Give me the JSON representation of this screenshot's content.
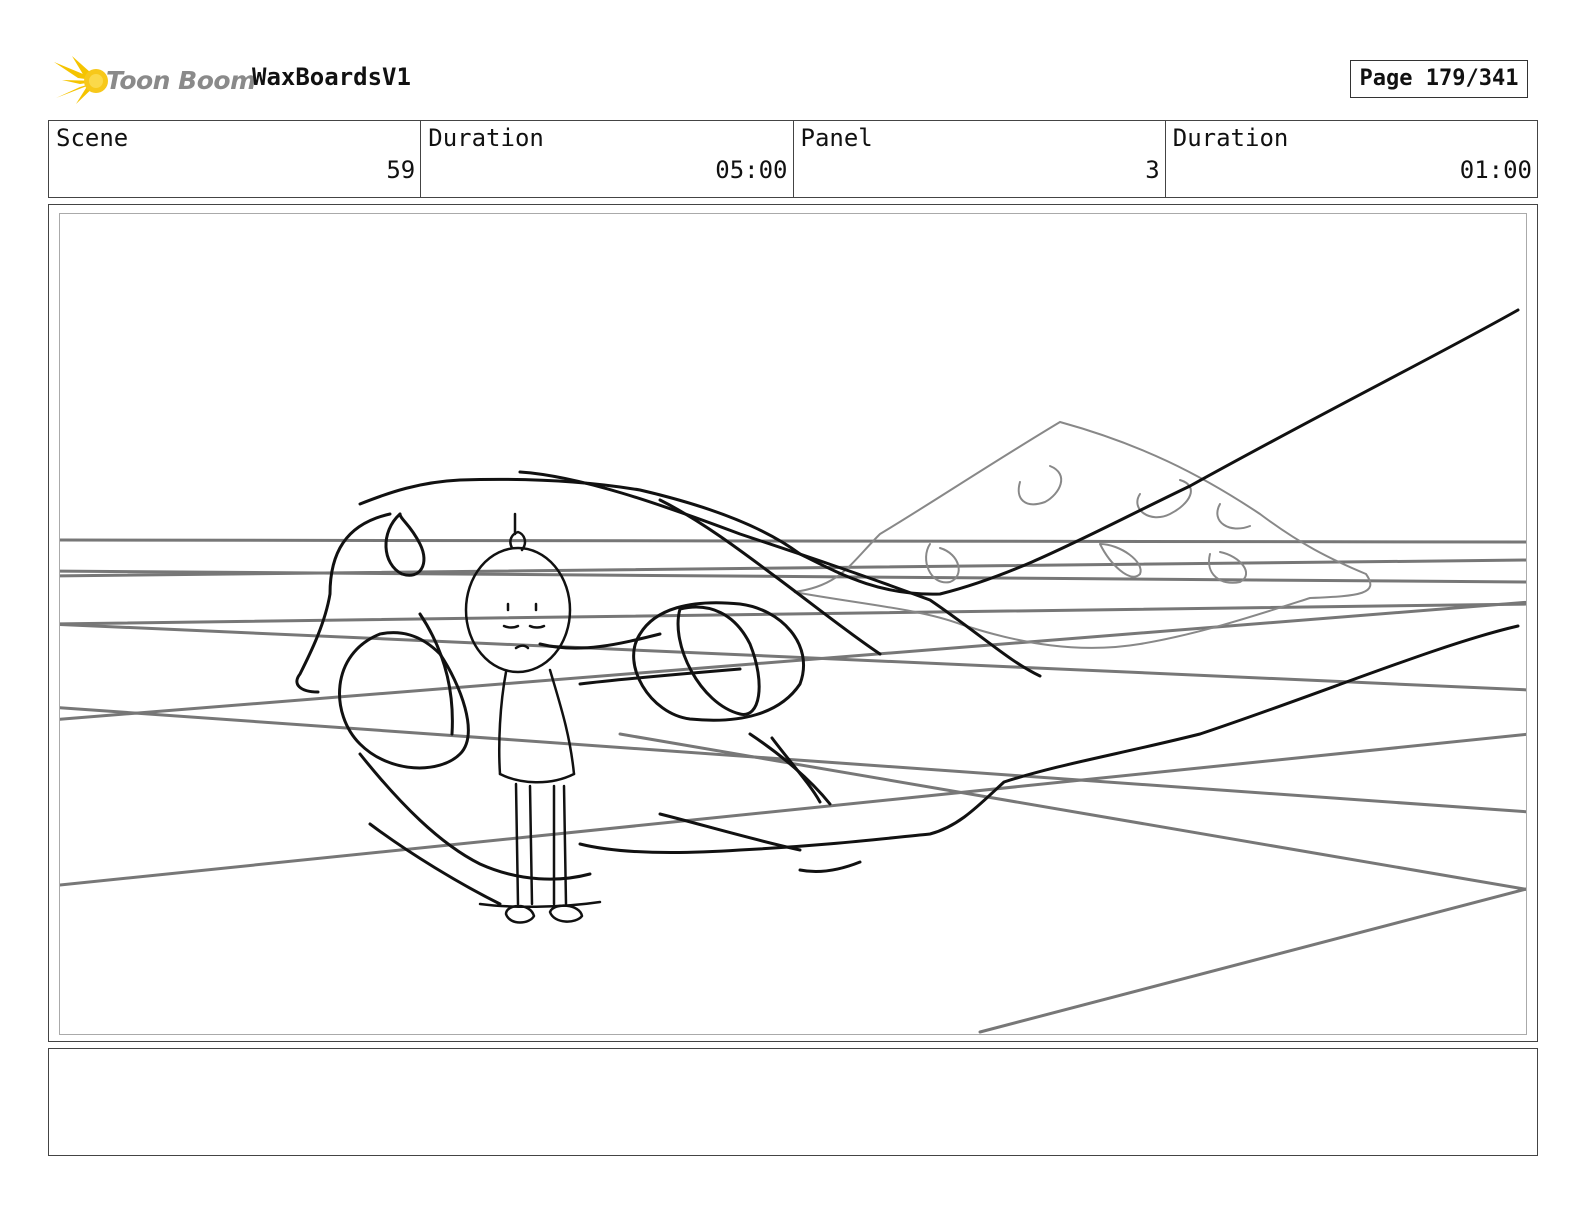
{
  "header": {
    "logo_text": "Toon Boom",
    "project_title": "WaxBoardsV1",
    "page_label": "Page 179/341"
  },
  "info": {
    "scene_label": "Scene",
    "scene_value": "59",
    "scene_duration_label": "Duration",
    "scene_duration_value": "05:00",
    "panel_label": "Panel",
    "panel_value": "3",
    "panel_duration_label": "Duration",
    "panel_duration_value": "01:00"
  },
  "colors": {
    "logo_yellow": "#f5c400",
    "logo_text": "#8a8a8a",
    "sketch_dark": "#111111",
    "sketch_grey": "#777777"
  },
  "notes": {
    "text": ""
  }
}
